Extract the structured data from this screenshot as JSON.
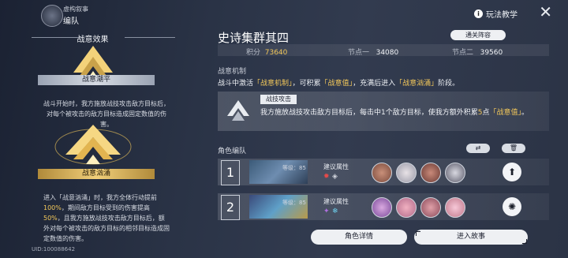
{
  "header": {
    "subtitle": "虚构叙事",
    "title": "编队",
    "help_label": "玩法教学"
  },
  "left_panel": {
    "section_title": "战意效果",
    "state_calm": "战意潮平",
    "calm_desc": "战斗开始时，我方施放战技攻击敌方目标后，对每个被攻击的敌方目标造成固定数值的伤害。",
    "state_surge": "战意汹涌",
    "surge_desc_parts": [
      "进入「战意汹涌」时，我方全体行动提前",
      "100%",
      "，期间敌方目标受到的伤害提高",
      "50%",
      "，且我方施放战技攻击敌方目标后，额外对每个被攻击的敌方目标的相邻目标造成固定数值的伤害。"
    ],
    "uid": "UID:100088642"
  },
  "stage": {
    "title": "史诗集群其四",
    "recommend_button": "通关阵容",
    "score_label": "积分",
    "score_value": "73640",
    "node1_label": "节点一",
    "node1_value": "34080",
    "node2_label": "节点二",
    "node2_value": "39560"
  },
  "mechanic": {
    "title": "战意机制",
    "text_parts": [
      "战斗中激活",
      "「战意机制」",
      "，可积累",
      "「战意值」",
      "，充满后进入",
      "「战意汹涌」",
      "阶段。"
    ],
    "skill_tag": "战技攻击",
    "skill_text_parts": [
      "我方施放战技攻击敌方目标后，每击中1个敌方目标，使我方额外积累",
      "5",
      "点",
      "「战意值」",
      "。"
    ]
  },
  "team": {
    "label": "角色编队",
    "rows": [
      {
        "num": "1",
        "level": "等级：85",
        "attr_label": "建议属性",
        "path_icon": "destruction-path-icon"
      },
      {
        "num": "2",
        "level": "等级：85",
        "attr_label": "建议属性",
        "path_icon": "erudition-path-icon"
      }
    ]
  },
  "buttons": {
    "detail": "角色详情",
    "enter": "进入故事"
  },
  "colors": {
    "gold": "#f0c65a",
    "accent_red": "#e64a4a"
  }
}
